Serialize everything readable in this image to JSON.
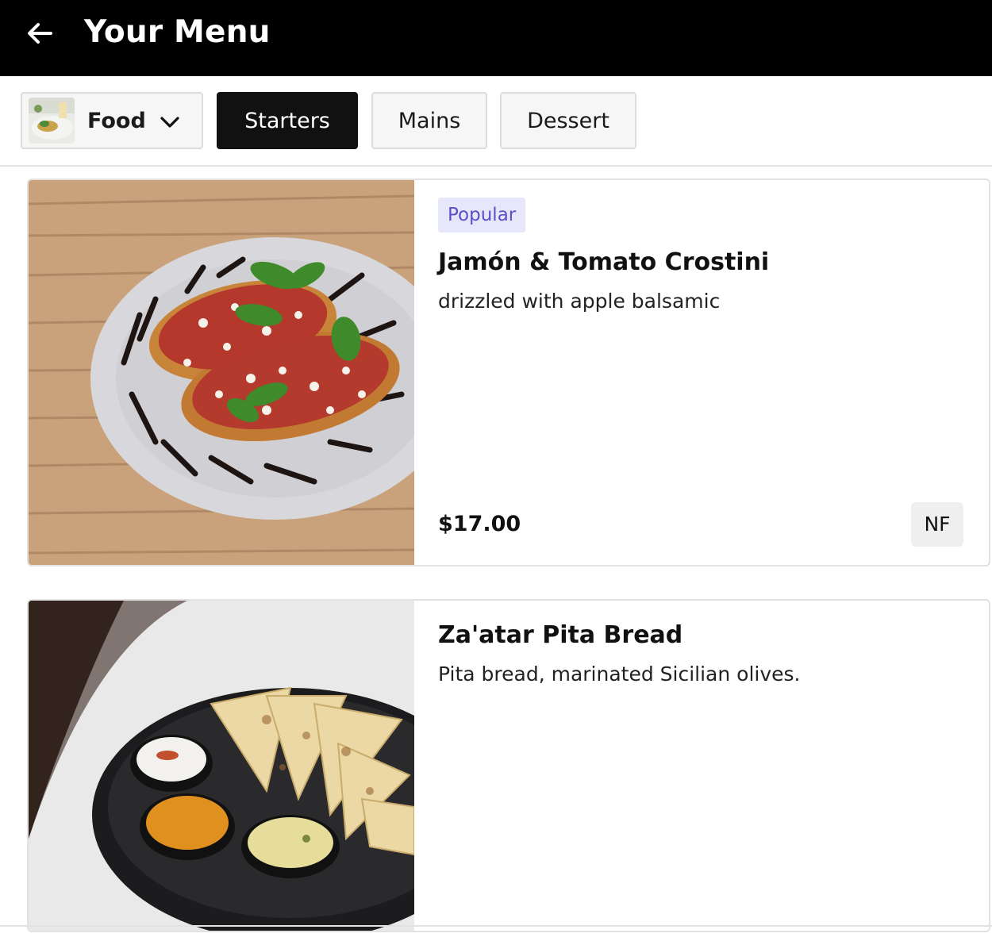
{
  "header": {
    "title": "Your Menu",
    "back_icon": "arrow-left-icon"
  },
  "category_bar": {
    "menu_select": {
      "label": "Food",
      "thumbnail": "food-thumbnail",
      "icon": "chevron-down-icon"
    },
    "tabs": [
      {
        "label": "Starters",
        "active": true
      },
      {
        "label": "Mains",
        "active": false
      },
      {
        "label": "Dessert",
        "active": false
      }
    ]
  },
  "items": [
    {
      "badge": "Popular",
      "name": "Jamón & Tomato Crostini",
      "description": "drizzled with apple balsamic",
      "price": "$17.00",
      "diet_tag": "NF",
      "image": "crostini-photo"
    },
    {
      "name": "Za'atar Pita Bread",
      "description": "Pita bread, marinated Sicilian olives.",
      "image": "pita-bread-photo"
    }
  ],
  "colors": {
    "header_bg": "#000000",
    "active_tab_bg": "#111111",
    "badge_bg": "#e7e7fb",
    "badge_text": "#5a4fc8",
    "card_border": "#e2e2e2"
  }
}
